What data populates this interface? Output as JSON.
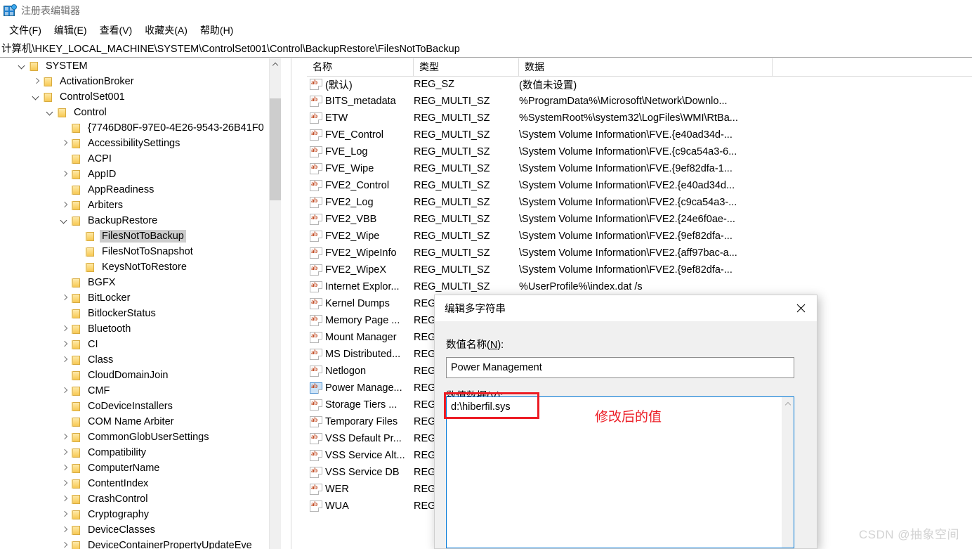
{
  "window": {
    "title": "注册表编辑器",
    "icon": "registry-editor-icon"
  },
  "menu": {
    "items": [
      {
        "label": "文件(F)"
      },
      {
        "label": "编辑(E)"
      },
      {
        "label": "查看(V)"
      },
      {
        "label": "收藏夹(A)"
      },
      {
        "label": "帮助(H)"
      }
    ]
  },
  "address": {
    "path": "计算机\\HKEY_LOCAL_MACHINE\\SYSTEM\\ControlSet001\\Control\\BackupRestore\\FilesNotToBackup"
  },
  "tree": {
    "nodes": [
      {
        "label": "SYSTEM",
        "indent": 0,
        "state": "expanded",
        "selected": false
      },
      {
        "label": "ActivationBroker",
        "indent": 1,
        "state": "collapsed",
        "selected": false
      },
      {
        "label": "ControlSet001",
        "indent": 1,
        "state": "expanded",
        "selected": false
      },
      {
        "label": "Control",
        "indent": 2,
        "state": "expanded",
        "selected": false
      },
      {
        "label": "{7746D80F-97E0-4E26-9543-26B41F0",
        "indent": 3,
        "state": "leaf",
        "selected": false
      },
      {
        "label": "AccessibilitySettings",
        "indent": 3,
        "state": "collapsed",
        "selected": false
      },
      {
        "label": "ACPI",
        "indent": 3,
        "state": "leaf",
        "selected": false
      },
      {
        "label": "AppID",
        "indent": 3,
        "state": "collapsed",
        "selected": false
      },
      {
        "label": "AppReadiness",
        "indent": 3,
        "state": "leaf",
        "selected": false
      },
      {
        "label": "Arbiters",
        "indent": 3,
        "state": "collapsed",
        "selected": false
      },
      {
        "label": "BackupRestore",
        "indent": 3,
        "state": "expanded",
        "selected": false
      },
      {
        "label": "FilesNotToBackup",
        "indent": 4,
        "state": "leaf",
        "selected": true
      },
      {
        "label": "FilesNotToSnapshot",
        "indent": 4,
        "state": "leaf",
        "selected": false
      },
      {
        "label": "KeysNotToRestore",
        "indent": 4,
        "state": "leaf",
        "selected": false
      },
      {
        "label": "BGFX",
        "indent": 3,
        "state": "leaf",
        "selected": false
      },
      {
        "label": "BitLocker",
        "indent": 3,
        "state": "collapsed",
        "selected": false
      },
      {
        "label": "BitlockerStatus",
        "indent": 3,
        "state": "leaf",
        "selected": false
      },
      {
        "label": "Bluetooth",
        "indent": 3,
        "state": "collapsed",
        "selected": false
      },
      {
        "label": "CI",
        "indent": 3,
        "state": "collapsed",
        "selected": false
      },
      {
        "label": "Class",
        "indent": 3,
        "state": "collapsed",
        "selected": false
      },
      {
        "label": "CloudDomainJoin",
        "indent": 3,
        "state": "leaf",
        "selected": false
      },
      {
        "label": "CMF",
        "indent": 3,
        "state": "collapsed",
        "selected": false
      },
      {
        "label": "CoDeviceInstallers",
        "indent": 3,
        "state": "leaf",
        "selected": false
      },
      {
        "label": "COM Name Arbiter",
        "indent": 3,
        "state": "leaf",
        "selected": false
      },
      {
        "label": "CommonGlobUserSettings",
        "indent": 3,
        "state": "collapsed",
        "selected": false
      },
      {
        "label": "Compatibility",
        "indent": 3,
        "state": "collapsed",
        "selected": false
      },
      {
        "label": "ComputerName",
        "indent": 3,
        "state": "collapsed",
        "selected": false
      },
      {
        "label": "ContentIndex",
        "indent": 3,
        "state": "collapsed",
        "selected": false
      },
      {
        "label": "CrashControl",
        "indent": 3,
        "state": "collapsed",
        "selected": false
      },
      {
        "label": "Cryptography",
        "indent": 3,
        "state": "collapsed",
        "selected": false
      },
      {
        "label": "DeviceClasses",
        "indent": 3,
        "state": "collapsed",
        "selected": false
      },
      {
        "label": "DeviceContainerPropertyUpdateEve",
        "indent": 3,
        "state": "collapsed",
        "selected": false
      }
    ]
  },
  "list": {
    "columns": [
      "名称",
      "类型",
      "数据"
    ],
    "rows": [
      {
        "name": "(默认)",
        "type": "REG_SZ",
        "data": "(数值未设置)",
        "selected": false
      },
      {
        "name": "BITS_metadata",
        "type": "REG_MULTI_SZ",
        "data": "%ProgramData%\\Microsoft\\Network\\Downlo...",
        "selected": false
      },
      {
        "name": "ETW",
        "type": "REG_MULTI_SZ",
        "data": "%SystemRoot%\\system32\\LogFiles\\WMI\\RtBa...",
        "selected": false
      },
      {
        "name": "FVE_Control",
        "type": "REG_MULTI_SZ",
        "data": "\\System Volume Information\\FVE.{e40ad34d-...",
        "selected": false
      },
      {
        "name": "FVE_Log",
        "type": "REG_MULTI_SZ",
        "data": "\\System Volume Information\\FVE.{c9ca54a3-6...",
        "selected": false
      },
      {
        "name": "FVE_Wipe",
        "type": "REG_MULTI_SZ",
        "data": "\\System Volume Information\\FVE.{9ef82dfa-1...",
        "selected": false
      },
      {
        "name": "FVE2_Control",
        "type": "REG_MULTI_SZ",
        "data": "\\System Volume Information\\FVE2.{e40ad34d...",
        "selected": false
      },
      {
        "name": "FVE2_Log",
        "type": "REG_MULTI_SZ",
        "data": "\\System Volume Information\\FVE2.{c9ca54a3-...",
        "selected": false
      },
      {
        "name": "FVE2_VBB",
        "type": "REG_MULTI_SZ",
        "data": "\\System Volume Information\\FVE2.{24e6f0ae-...",
        "selected": false
      },
      {
        "name": "FVE2_Wipe",
        "type": "REG_MULTI_SZ",
        "data": "\\System Volume Information\\FVE2.{9ef82dfa-...",
        "selected": false
      },
      {
        "name": "FVE2_WipeInfo",
        "type": "REG_MULTI_SZ",
        "data": "\\System Volume Information\\FVE2.{aff97bac-a...",
        "selected": false
      },
      {
        "name": "FVE2_WipeX",
        "type": "REG_MULTI_SZ",
        "data": "\\System Volume Information\\FVE2.{9ef82dfa-...",
        "selected": false
      },
      {
        "name": "Internet Explor...",
        "type": "REG_MULTI_SZ",
        "data": "%UserProfile%\\index.dat /s",
        "selected": false
      },
      {
        "name": "Kernel Dumps",
        "type": "REG",
        "data": "",
        "selected": false
      },
      {
        "name": "Memory Page ...",
        "type": "REG",
        "data": "",
        "selected": false
      },
      {
        "name": "Mount Manager",
        "type": "REG",
        "data": "",
        "selected": false
      },
      {
        "name": "MS Distributed...",
        "type": "REG",
        "data": "",
        "selected": false
      },
      {
        "name": "Netlogon",
        "type": "REG",
        "data": "",
        "selected": false
      },
      {
        "name": "Power Manage...",
        "type": "REG",
        "data": "",
        "selected": true
      },
      {
        "name": "Storage Tiers ...",
        "type": "REG",
        "data": "",
        "selected": false
      },
      {
        "name": "Temporary Files",
        "type": "REG",
        "data": "",
        "selected": false
      },
      {
        "name": "VSS Default Pr...",
        "type": "REG",
        "data": "",
        "selected": false
      },
      {
        "name": "VSS Service Alt...",
        "type": "REG",
        "data": "",
        "selected": false
      },
      {
        "name": "VSS Service DB",
        "type": "REG",
        "data": "",
        "selected": false
      },
      {
        "name": "WER",
        "type": "REG",
        "data": "",
        "selected": false
      },
      {
        "name": "WUA",
        "type": "REG",
        "data": "",
        "selected": false
      }
    ]
  },
  "dialog": {
    "title": "编辑多字符串",
    "close_label": "×",
    "name_label_pre": "数值名称(",
    "name_label_key": "N",
    "name_label_post": "):",
    "name_value": "Power Management",
    "data_label_pre": "数值数据(",
    "data_label_key": "V",
    "data_label_post": "):",
    "data_value": "d:\\hiberfil.sys"
  },
  "annotation": {
    "text": "修改后的值",
    "color": "#ec1c24"
  },
  "watermark": {
    "text": "CSDN @抽象空间"
  }
}
